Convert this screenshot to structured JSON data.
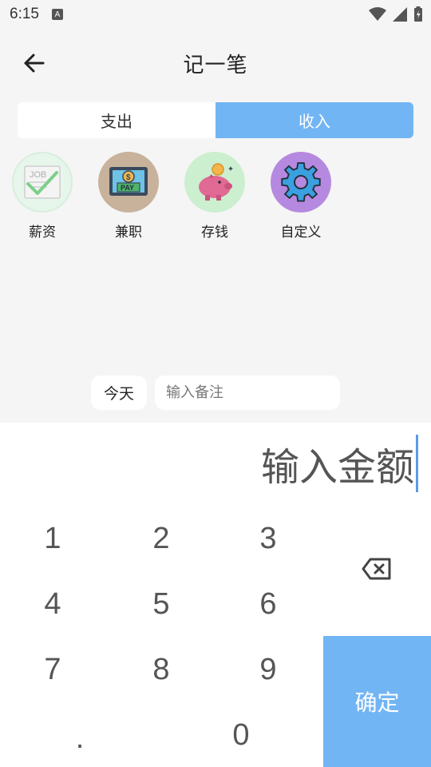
{
  "status_bar": {
    "time": "6:15",
    "notification_icon": "A"
  },
  "header": {
    "title": "记一笔",
    "back_icon": "arrow-left-icon"
  },
  "tabs": [
    {
      "label": "支出",
      "active": false
    },
    {
      "label": "收入",
      "active": true
    }
  ],
  "categories": [
    {
      "label": "薪资",
      "icon": "salary-envelope-icon",
      "color": "#e6f6ea"
    },
    {
      "label": "兼职",
      "icon": "part-time-pay-icon",
      "color": "#c8b29c"
    },
    {
      "label": "存钱",
      "icon": "piggy-bank-icon",
      "color": "#ccefcf"
    },
    {
      "label": "自定义",
      "icon": "gear-icon",
      "color": "#b689e0"
    }
  ],
  "remark": {
    "date_label": "今天",
    "placeholder": "输入备注"
  },
  "amount": {
    "placeholder": "输入金额"
  },
  "keypad": {
    "keys": [
      "1",
      "2",
      "3",
      "4",
      "5",
      "6",
      "7",
      "8",
      "9",
      ".",
      "0"
    ],
    "backspace_icon": "backspace-icon",
    "confirm_label": "确定"
  },
  "colors": {
    "accent": "#72b5f4",
    "background": "#f5f5f5"
  }
}
